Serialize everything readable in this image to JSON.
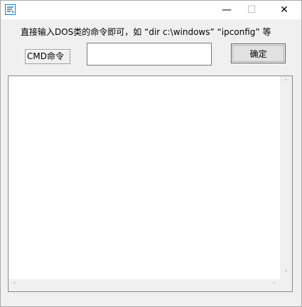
{
  "window": {
    "controls": {
      "minimize": "—",
      "maximize": "☐",
      "close": "✕"
    }
  },
  "instruction_text": "直接输入DOS类的命令即可，如 “dir c:\\windows” “ipconfig” 等",
  "cmd_label": "CMD命令",
  "cmd_input": {
    "value": "",
    "placeholder": ""
  },
  "ok_button_label": "确定",
  "output": {
    "text": "",
    "scroll_arrows": {
      "up": "˄",
      "down": "˅",
      "left": "˂",
      "right": "˃"
    }
  },
  "colors": {
    "window_bg": "#f0f0f0",
    "titlebar_bg": "#ffffff",
    "icon_blue": "#2b7bb9",
    "border": "#828790"
  }
}
